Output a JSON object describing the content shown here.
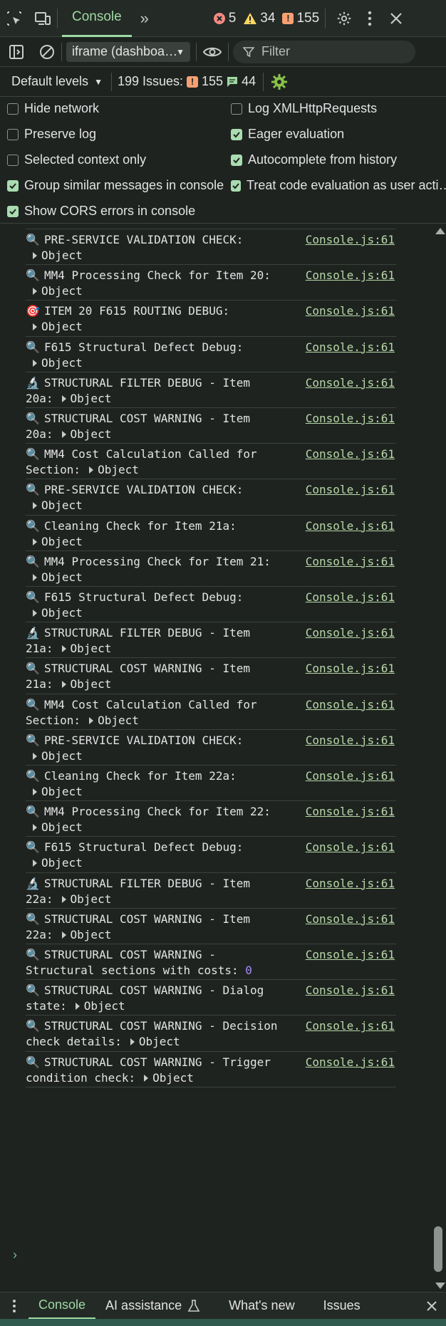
{
  "topbar": {
    "tab_console": "Console",
    "errors": "5",
    "warnings": "34",
    "issues": "155"
  },
  "toolbar": {
    "context": "iframe (dashboa…",
    "filter_placeholder": "Filter"
  },
  "levels_bar": {
    "levels_label": "Default levels",
    "issues_label": "199 Issues:",
    "issues_count": "155",
    "messages_count": "44"
  },
  "settings": {
    "hide_network": "Hide network",
    "preserve_log": "Preserve log",
    "selected_context": "Selected context only",
    "group_similar": "Group similar messages in console",
    "show_cors": "Show CORS errors in console",
    "log_xhr": "Log XMLHttpRequests",
    "eager_eval": "Eager evaluation",
    "autocomplete": "Autocomplete from history",
    "treat_user_action": "Treat code evaluation as user acti…"
  },
  "source_link": "Console.js:61",
  "object_label": "Object",
  "messages": [
    {
      "icon": "magnifier-icon",
      "glyph": "🔍",
      "l1": "PRE-SERVICE VALIDATION CHECK:",
      "l2": ""
    },
    {
      "icon": "magnifier-icon",
      "glyph": "🔍",
      "l1": "MM4 Processing Check for Item 20:",
      "l2": ""
    },
    {
      "icon": "target-icon",
      "glyph": "🎯",
      "l1": "ITEM 20 F615 ROUTING DEBUG:",
      "l2": ""
    },
    {
      "icon": "magnifier-icon",
      "glyph": "🔍",
      "l1": "F615 Structural Defect Debug:",
      "l2": ""
    },
    {
      "icon": "microscope-icon",
      "glyph": "🔬",
      "l1": "STRUCTURAL FILTER DEBUG - Item",
      "l2": "20a:"
    },
    {
      "icon": "magnifier-icon",
      "glyph": "🔍",
      "l1": "STRUCTURAL COST WARNING - Item",
      "l2": "20a:"
    },
    {
      "icon": "magnifier-icon",
      "glyph": "🔍",
      "l1": "MM4 Cost Calculation Called for",
      "l2": "Section:"
    },
    {
      "icon": "magnifier-icon",
      "glyph": "🔍",
      "l1": "PRE-SERVICE VALIDATION CHECK:",
      "l2": ""
    },
    {
      "icon": "magnifier-icon",
      "glyph": "🔍",
      "l1": "Cleaning Check for Item 21a:",
      "l2": ""
    },
    {
      "icon": "magnifier-icon",
      "glyph": "🔍",
      "l1": "MM4 Processing Check for Item 21:",
      "l2": ""
    },
    {
      "icon": "magnifier-icon",
      "glyph": "🔍",
      "l1": "F615 Structural Defect Debug:",
      "l2": ""
    },
    {
      "icon": "microscope-icon",
      "glyph": "🔬",
      "l1": "STRUCTURAL FILTER DEBUG - Item",
      "l2": "21a:"
    },
    {
      "icon": "magnifier-icon",
      "glyph": "🔍",
      "l1": "STRUCTURAL COST WARNING - Item",
      "l2": "21a:"
    },
    {
      "icon": "magnifier-icon",
      "glyph": "🔍",
      "l1": "MM4 Cost Calculation Called for",
      "l2": "Section:"
    },
    {
      "icon": "magnifier-icon",
      "glyph": "🔍",
      "l1": "PRE-SERVICE VALIDATION CHECK:",
      "l2": ""
    },
    {
      "icon": "magnifier-icon",
      "glyph": "🔍",
      "l1": "Cleaning Check for Item 22a:",
      "l2": ""
    },
    {
      "icon": "magnifier-icon",
      "glyph": "🔍",
      "l1": "MM4 Processing Check for Item 22:",
      "l2": ""
    },
    {
      "icon": "magnifier-icon",
      "glyph": "🔍",
      "l1": "F615 Structural Defect Debug:",
      "l2": ""
    },
    {
      "icon": "microscope-icon",
      "glyph": "🔬",
      "l1": "STRUCTURAL FILTER DEBUG - Item",
      "l2": "22a:"
    },
    {
      "icon": "magnifier-icon",
      "glyph": "🔍",
      "l1": "STRUCTURAL COST WARNING - Item",
      "l2": "22a:"
    },
    {
      "icon": "magnifier-icon",
      "glyph": "🔍",
      "l1": "STRUCTURAL COST WARNING -",
      "l2": "Structural sections with costs:",
      "value": "0"
    },
    {
      "icon": "magnifier-icon",
      "glyph": "🔍",
      "l1": "STRUCTURAL COST WARNING - Dialog",
      "l2": "state:"
    },
    {
      "icon": "magnifier-icon",
      "glyph": "🔍",
      "l1": "STRUCTURAL COST WARNING - Decision",
      "l2": "check details:"
    },
    {
      "icon": "magnifier-icon",
      "glyph": "🔍",
      "l1": "STRUCTURAL COST WARNING - Trigger",
      "l2": "condition check:"
    }
  ],
  "bottombar": {
    "tab_console": "Console",
    "tab_ai": "AI assistance",
    "tab_whats_new": "What's new",
    "tab_issues": "Issues"
  },
  "colors": {
    "accent": "#9fd9a3",
    "error": "#f28b82",
    "warning": "#fdd663",
    "issue": "#f7a072",
    "link": "#b7d8a7",
    "number": "#a68cf5"
  }
}
